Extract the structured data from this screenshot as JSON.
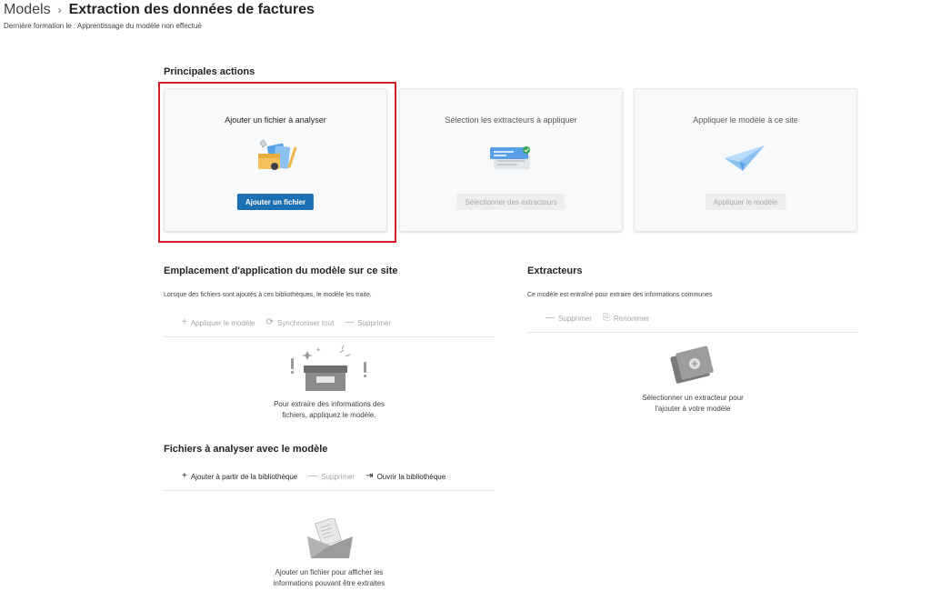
{
  "header": {
    "breadcrumb_root": "Models",
    "title": "Extraction des données de factures",
    "subtitle": "Dernière formation le : Apprentissage du modèle non effectué"
  },
  "main_actions": {
    "title": "Principales actions",
    "cards": [
      {
        "title": "Ajouter un fichier à analyser",
        "button": "Ajouter un fichier",
        "enabled": true
      },
      {
        "title": "Sélection les extracteurs à appliquer",
        "button": "Sélectionner des extracteurs",
        "enabled": false
      },
      {
        "title": "Appliquer le modèle à ce site",
        "button": "Appliquer le modèle",
        "enabled": false
      }
    ]
  },
  "apply_location": {
    "title": "Emplacement d'application du modèle sur ce site",
    "description": "Lorsque des fichiers sont ajoutés à ces bibliothèques, le modèle les traite.",
    "toolbar": {
      "apply": "Appliquer le modèle",
      "sync": "Synchroniser tout",
      "delete": "Supprimer"
    },
    "empty_line1": "Pour extraire des informations des",
    "empty_line2": "fichiers, appliquez le modèle."
  },
  "extractors": {
    "title": "Extracteurs",
    "description": "Ce modèle est entraîné pour extraire des informations communes",
    "toolbar": {
      "delete": "Supprimer",
      "rename": "Renommer"
    },
    "empty_line1": "Sélectionner un extracteur pour",
    "empty_line2": "l'ajouter à votre modèle"
  },
  "files": {
    "title": "Fichiers à analyser avec le modèle",
    "toolbar": {
      "add": "Ajouter à partir de la bibliothèque",
      "delete": "Supprimer",
      "open": "Ouvrir la bibliothèque"
    },
    "empty_line1": "Ajouter un fichier pour afficher les",
    "empty_line2": "informations pouvant être extraites"
  },
  "colors": {
    "primary": "#1b6fb3",
    "highlight": "#d2202a",
    "disabled_text": "#a6a6a6"
  },
  "icons": {
    "add": "plus-icon",
    "sync": "sync-icon",
    "delete": "minus-icon",
    "rename": "rename-icon",
    "open": "open-arrow-icon"
  }
}
